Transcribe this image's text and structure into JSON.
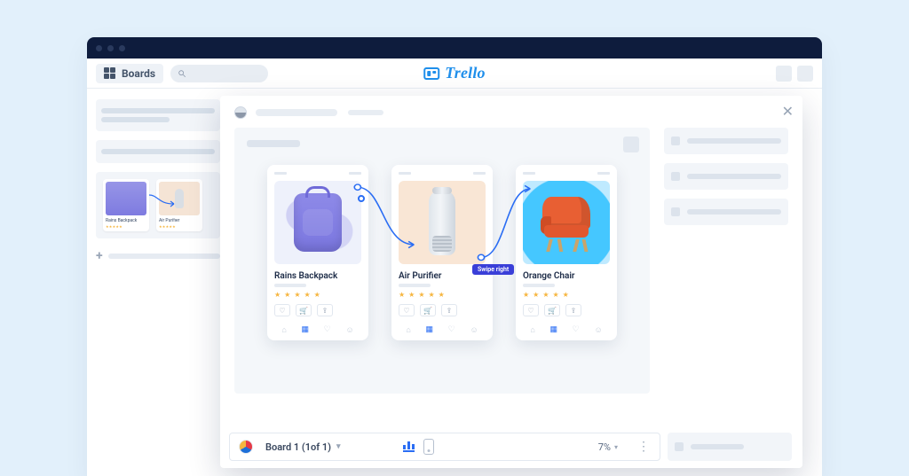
{
  "appbar": {
    "boards_label": "Boards",
    "brand_word": "Trello"
  },
  "sidebar": {
    "mini_cards": [
      {
        "title": "Rains Backpack",
        "stars": "★★★★★"
      },
      {
        "title": "Air Purifier",
        "stars": "★★★★★"
      }
    ]
  },
  "modal": {
    "canvas": {
      "swipe_label": "Swipe right"
    },
    "phones": [
      {
        "title": "Rains Backpack",
        "stars": "★ ★ ★ ★ ★"
      },
      {
        "title": "Air Purifier",
        "stars": "★ ★ ★ ★ ★"
      },
      {
        "title": "Orange Chair",
        "stars": "★ ★ ★ ★ ★"
      }
    ],
    "footer": {
      "board_label": "Board 1 (1of 1)",
      "zoom_pct": "7%"
    }
  }
}
